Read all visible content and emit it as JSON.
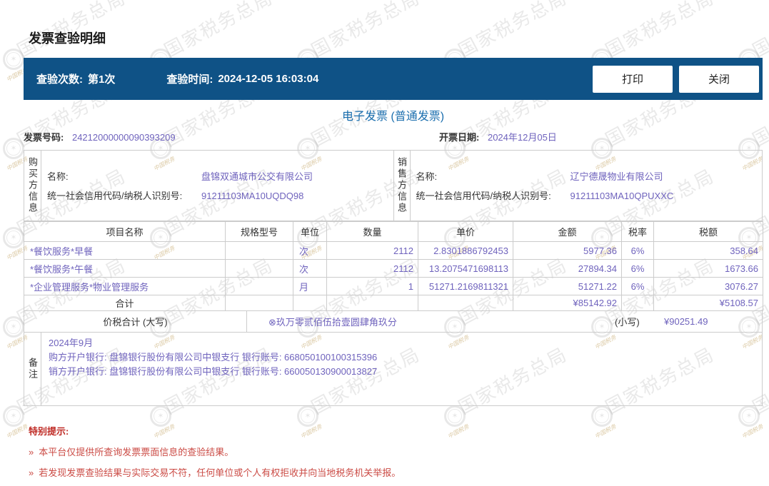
{
  "page": {
    "title": "发票查验明细"
  },
  "topbar": {
    "check_count_label": "查验次数:",
    "check_count_value": "第1次",
    "check_time_label": "查验时间:",
    "check_time_value": "2024-12-05 16:03:04",
    "print_button": "打印",
    "close_button": "关闭"
  },
  "invoice": {
    "type_title": "电子发票 (普通发票)",
    "number_label": "发票号码:",
    "number": "24212000000090393209",
    "date_label": "开票日期:",
    "date": "2024年12月05日",
    "buyer": {
      "side_label": "购买方信息",
      "name_label": "名称:",
      "name": "盘锦双通城市公交有限公司",
      "taxid_label": "统一社会信用代码/纳税人识别号:",
      "taxid": "91211103MA10UQDQ98"
    },
    "seller": {
      "side_label": "销售方信息",
      "name_label": "名称:",
      "name": "辽宁德晟物业有限公司",
      "taxid_label": "统一社会信用代码/纳税人识别号:",
      "taxid": "91211103MA10QPUXXC"
    },
    "items_table": {
      "headers": [
        "项目名称",
        "规格型号",
        "单位",
        "数量",
        "单价",
        "金额",
        "税率",
        "税额"
      ],
      "rows": [
        {
          "name": "*餐饮服务*早餐",
          "spec": "",
          "unit": "次",
          "qty": "2112",
          "price": "2.8301886792453",
          "amount": "5977.36",
          "tax_rate": "6%",
          "tax": "358.64"
        },
        {
          "name": "*餐饮服务*午餐",
          "spec": "",
          "unit": "次",
          "qty": "2112",
          "price": "13.2075471698113",
          "amount": "27894.34",
          "tax_rate": "6%",
          "tax": "1673.66"
        },
        {
          "name": "*企业管理服务*物业管理服务",
          "spec": "",
          "unit": "月",
          "qty": "1",
          "price": "51271.2169811321",
          "amount": "51271.22",
          "tax_rate": "6%",
          "tax": "3076.27"
        }
      ],
      "total_label": "合计",
      "total_amount": "¥85142.92",
      "total_tax": "¥5108.57"
    },
    "total_row": {
      "label": "价税合计 (大写)",
      "words": "⊗玖万零贰佰伍拾壹圆肆角玖分",
      "small_label": "(小写)",
      "small_value": "¥90251.49"
    },
    "remarks": {
      "side_label": "备注",
      "lines": [
        "2024年9月",
        "购方开户银行: 盘锦银行股份有限公司中银支行 银行账号: 668050100100315396",
        "销方开户银行: 盘锦银行股份有限公司中银支行 银行账号: 660050130900013827"
      ]
    }
  },
  "footer": {
    "title": "特别提示:",
    "bullet": "»",
    "notes": [
      "本平台仅提供所查询发票票面信息的查验结果。",
      "若发现发票查验结果与实际交易不符，任何单位或个人有权拒收并向当地税务机关举报。"
    ]
  },
  "watermark": {
    "text": "国家税务总局",
    "subtext": "中国税务"
  },
  "colors": {
    "accent_bar": "#0f5286",
    "title_blue": "#1a6eae",
    "value_purple": "#6f63bd",
    "border_gray": "#cccccc",
    "warning_title_red": "#bf2b25",
    "warning_text_red": "#cb4b45"
  }
}
